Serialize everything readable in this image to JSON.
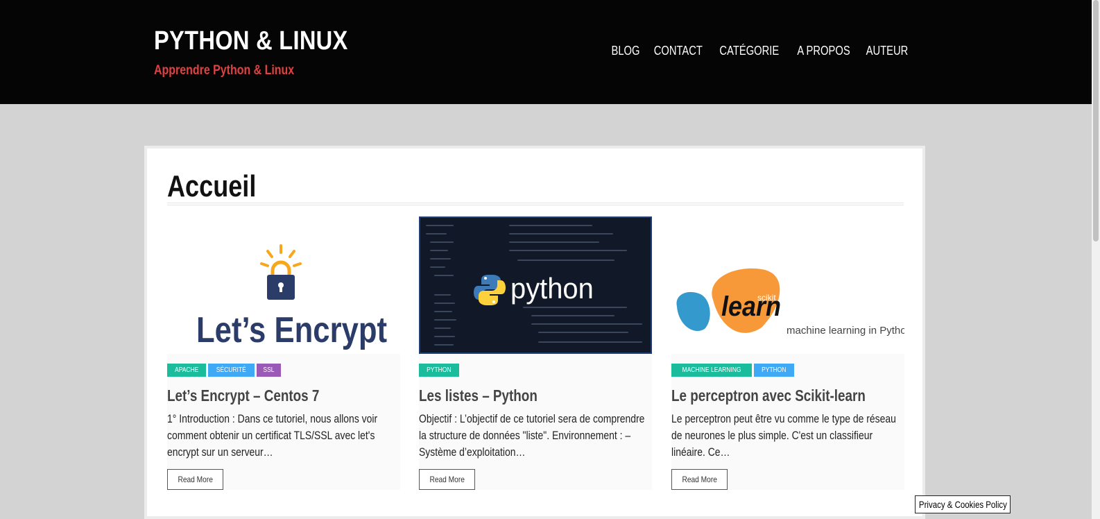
{
  "header": {
    "site_title": "PYTHON & LINUX",
    "tagline": "Apprendre Python & Linux",
    "nav": [
      "BLOG",
      "CONTACT",
      "CATÉGORIE",
      "A PROPOS",
      "AUTEUR"
    ]
  },
  "page": {
    "title": "Accueil"
  },
  "posts": [
    {
      "image_text": "Let’s Encrypt",
      "categories": [
        {
          "label": "APACHE",
          "color": "#1abc9c"
        },
        {
          "label": "SÉCURITÉ",
          "color": "#3fa9f5"
        },
        {
          "label": "SSL",
          "color": "#9b59b6"
        }
      ],
      "title": "Let’s Encrypt – Centos 7",
      "excerpt": "1° Introduction : Dans ce tutoriel, nous allons voir comment obtenir un certificat TLS/SSL avec let's encrypt sur un serveur…",
      "read_more": "Read More"
    },
    {
      "image_text": "python",
      "categories": [
        {
          "label": "PYTHON",
          "color": "#1abc9c"
        }
      ],
      "title": "Les listes – Python",
      "excerpt": "  Objectif : L’objectif de ce tutoriel sera de comprendre la structure de données \"liste\". Environnement : – Système d’exploitation…",
      "read_more": "Read More"
    },
    {
      "image_text": "learn",
      "image_badge": "scikit",
      "image_caption": "machine learning in Python",
      "categories": [
        {
          "label": "MACHINE LEARNING",
          "color": "#1abc9c"
        },
        {
          "label": "PYTHON",
          "color": "#3fa9f5"
        }
      ],
      "title": "Le perceptron avec Scikit-learn",
      "excerpt": "Le perceptron peut être vu comme le type de réseau de neurones le plus simple. C'est un classifieur linéaire. Ce…",
      "read_more": "Read More"
    }
  ],
  "footer": {
    "privacy": "Privacy & Cookies Policy"
  }
}
